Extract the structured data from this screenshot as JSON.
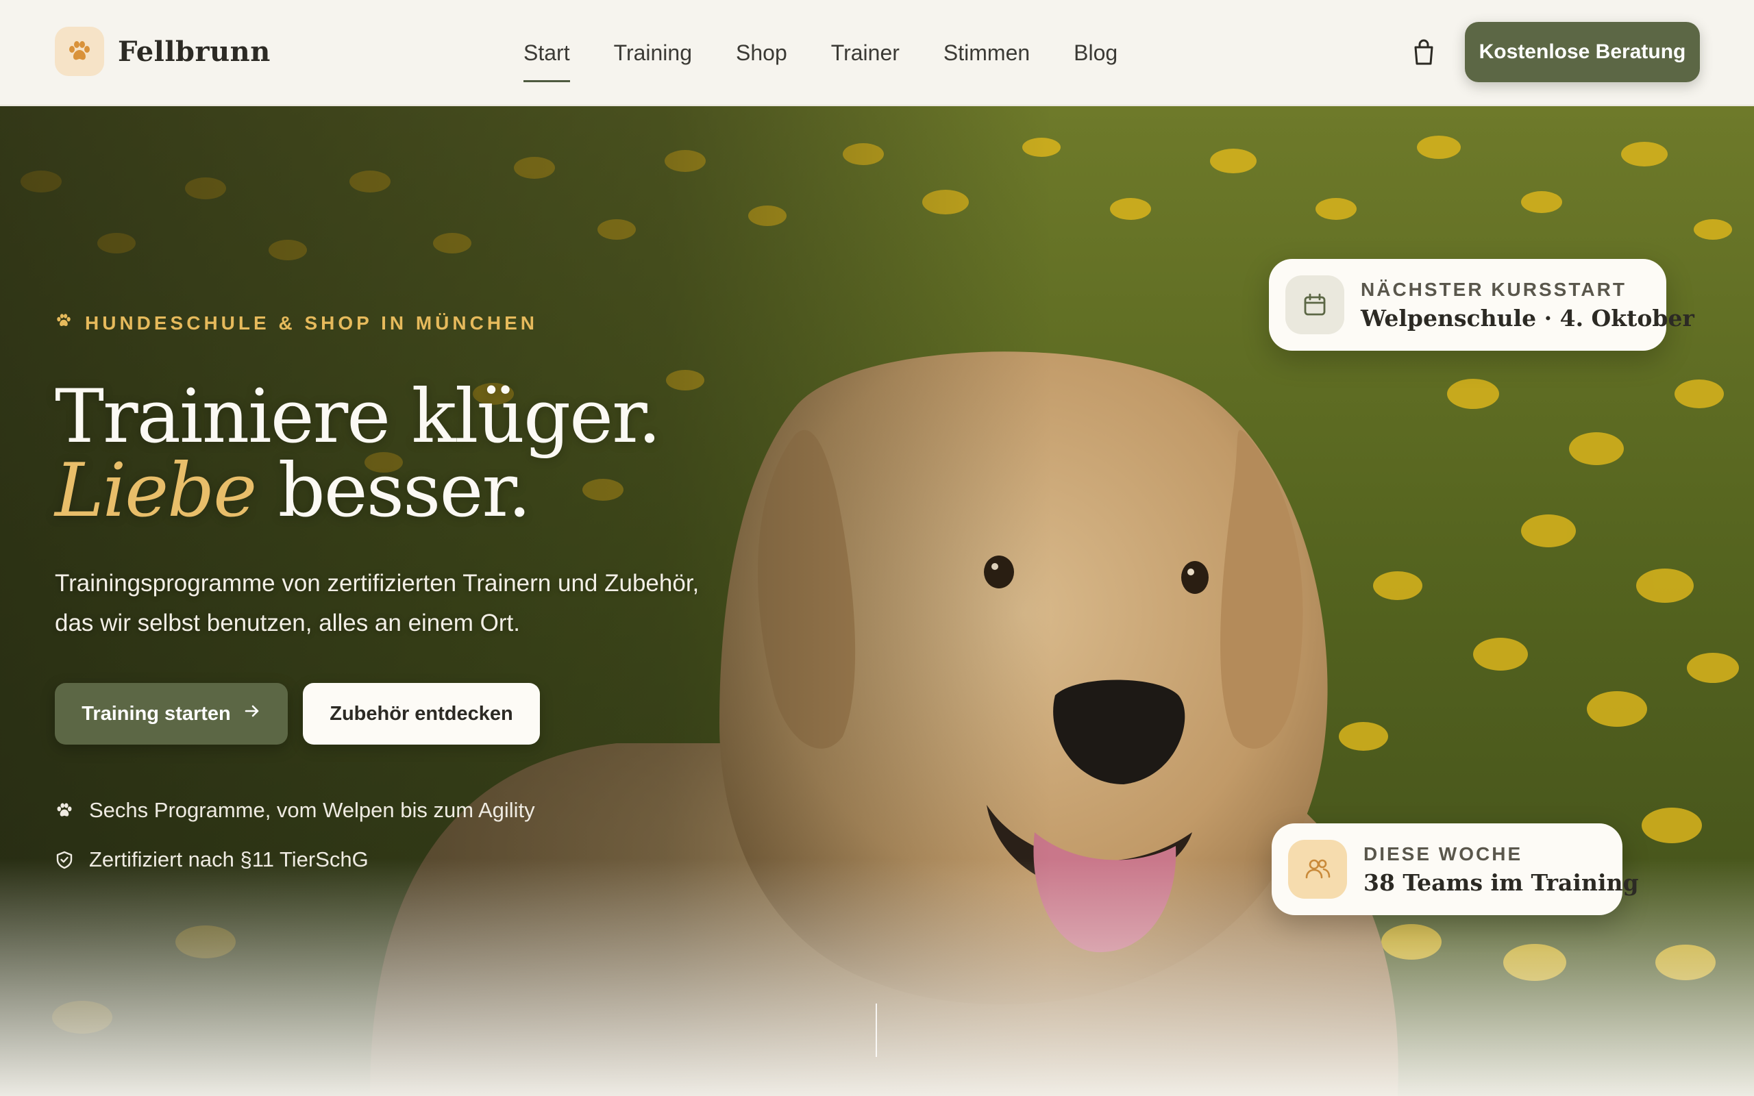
{
  "brand": {
    "name": "Fellbrunn",
    "icon": "paw-icon"
  },
  "nav": {
    "items": [
      {
        "label": "Start",
        "active": true
      },
      {
        "label": "Training"
      },
      {
        "label": "Shop"
      },
      {
        "label": "Trainer"
      },
      {
        "label": "Stimmen"
      },
      {
        "label": "Blog"
      }
    ],
    "cart_icon": "shopping-bag-icon",
    "cta_label": "Kostenlose Beratung"
  },
  "hero": {
    "eyebrow": "HUNDESCHULE & SHOP IN MÜNCHEN",
    "headline_line1": "Trainiere klüger.",
    "headline_accent": "Liebe",
    "headline_rest": " besser.",
    "subtext": "Trainingsprogramme von zertifizierten Trainern und Zubehör, das wir selbst benutzen, alles an einem Ort.",
    "primary_button": "Training starten",
    "secondary_button": "Zubehör entdecken",
    "features": [
      {
        "icon": "paw-icon",
        "text": "Sechs Programme, vom Welpen bis zum Agility"
      },
      {
        "icon": "shield-check-icon",
        "text": "Zertifiziert nach §11 TierSchG"
      }
    ]
  },
  "cards": {
    "next_course": {
      "icon": "calendar-icon",
      "label": "NÄCHSTER KURSSTART",
      "value": "Welpenschule · 4. Oktober"
    },
    "this_week": {
      "icon": "users-icon",
      "label": "DIESE WOCHE",
      "value": "38 Teams im Training"
    }
  },
  "colors": {
    "accent_green": "#5c6745",
    "accent_gold": "#e8be6a",
    "background": "#f6f4ee"
  }
}
